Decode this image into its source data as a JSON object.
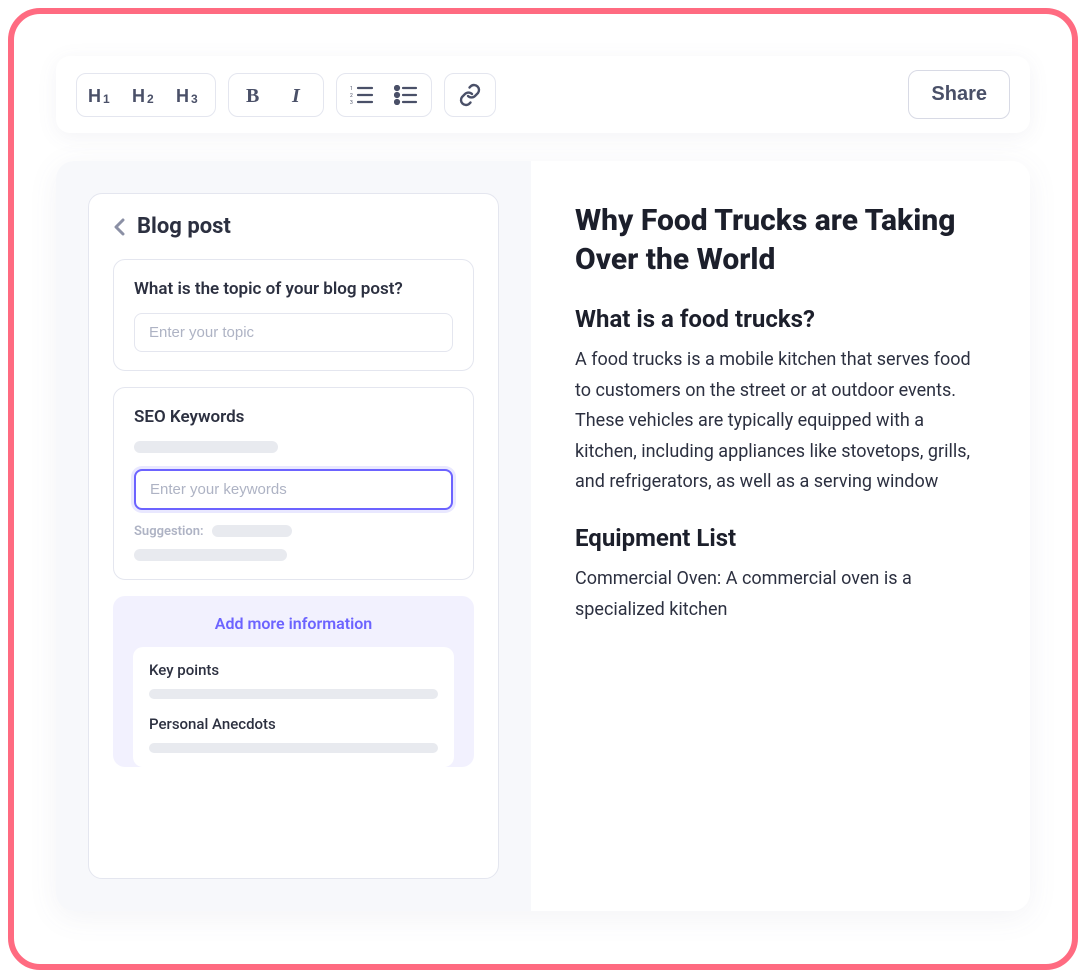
{
  "toolbar": {
    "share_label": "Share"
  },
  "sidebar": {
    "title": "Blog post",
    "topic_card": {
      "label": "What is the topic of your blog post?",
      "placeholder": "Enter your topic"
    },
    "seo_card": {
      "label": "SEO Keywords",
      "placeholder": "Enter your keywords",
      "suggestion_label": "Suggestion:"
    },
    "add_more": {
      "title": "Add more information",
      "key_points_label": "Key points",
      "anecdotes_label": "Personal Anecdots"
    }
  },
  "content": {
    "title": "Why Food Trucks are Taking Over the World",
    "h2_1": "What is a food trucks?",
    "p1": "A food trucks is a mobile kitchen that serves food to customers on the street or at outdoor events. These vehicles are typically equipped with a kitchen, including appliances like stovetops, grills, and refrigerators, as well as a serving window",
    "h2_2": "Equipment List",
    "p2": "Commercial Oven: A commercial oven is a specialized kitchen"
  }
}
